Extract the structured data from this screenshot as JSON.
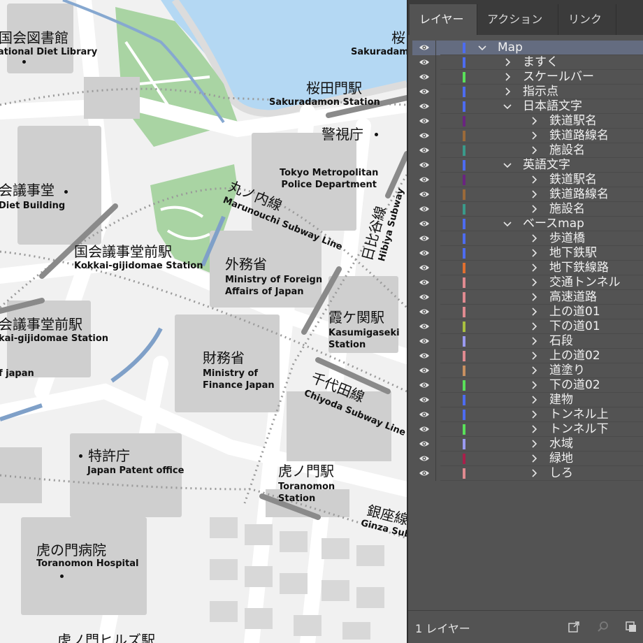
{
  "map": {
    "labels": [
      {
        "jp": "国会図書館",
        "en": "National Diet Library"
      },
      {
        "jp": "桜",
        "en": "Sakuradamon"
      },
      {
        "jp": "桜田門駅",
        "en": "Sakuradamon Station"
      },
      {
        "jp": "警視庁",
        "en": "Tokyo Metropolitan\nPolice Department"
      },
      {
        "jp": "会議事堂",
        "en": "Diet Building"
      },
      {
        "jp": "丸ノ内線",
        "en": "Marunouchi Subway Line"
      },
      {
        "jp": "日比谷線",
        "en": "Hibiya Subway"
      },
      {
        "jp": "国会議事堂前駅",
        "en": "Kokkai-gijidomae Station"
      },
      {
        "jp": "外務省",
        "en": "Ministry of Foreign\nAffairs of Japan"
      },
      {
        "jp": "会議事堂前駅",
        "en": "kai-gijidomae Station"
      },
      {
        "jp": "霞ケ関駅",
        "en": "Kasumigaseki\nStation"
      },
      {
        "jp": "",
        "en": "f japan"
      },
      {
        "jp": "財務省",
        "en": "Ministry of\nFinance Japan"
      },
      {
        "jp": "千代田線",
        "en": "Chiyoda Subway Line"
      },
      {
        "jp": "特許庁",
        "en": "Japan Patent office"
      },
      {
        "jp": "虎ノ門駅",
        "en": "Toranomon\nStation"
      },
      {
        "jp": "銀座線",
        "en": "Ginza Sub"
      },
      {
        "jp": "虎の門病院",
        "en": "Toranomon Hospital"
      },
      {
        "jp": "虎ノ門ヒルズ駅",
        "en": ""
      }
    ]
  },
  "panel": {
    "tabs": [
      "レイヤー",
      "アクション",
      "リンク"
    ],
    "layers": [
      {
        "name": "Map",
        "color": "#4d6cf0",
        "level": 0,
        "expanded": true,
        "selected": true
      },
      {
        "name": "ますく",
        "color": "#4d6cf0",
        "level": 1,
        "expanded": false
      },
      {
        "name": "スケールバー",
        "color": "#5ae05a",
        "level": 1,
        "expanded": false
      },
      {
        "name": "指示点",
        "color": "#4d6cf0",
        "level": 1,
        "expanded": false
      },
      {
        "name": "日本語文字",
        "color": "#4d6cf0",
        "level": 1,
        "expanded": true
      },
      {
        "name": "鉄道駅名",
        "color": "#6a2480",
        "level": 2,
        "expanded": false
      },
      {
        "name": "鉄道路線名",
        "color": "#9a6a3a",
        "level": 2,
        "expanded": false
      },
      {
        "name": "施設名",
        "color": "#3a9a8a",
        "level": 2,
        "expanded": false
      },
      {
        "name": "英語文字",
        "color": "#4d6cf0",
        "level": 1,
        "expanded": true
      },
      {
        "name": "鉄道駅名",
        "color": "#6a2480",
        "level": 2,
        "expanded": false
      },
      {
        "name": "鉄道路線名",
        "color": "#9a6a3a",
        "level": 2,
        "expanded": false
      },
      {
        "name": "施設名",
        "color": "#3a9a8a",
        "level": 2,
        "expanded": false
      },
      {
        "name": "ベースmap",
        "color": "#4d6cf0",
        "level": 1,
        "expanded": true
      },
      {
        "name": "歩道橋",
        "color": "#4d6cf0",
        "level": 2,
        "expanded": false
      },
      {
        "name": "地下鉄駅",
        "color": "#4d6cf0",
        "level": 2,
        "expanded": false
      },
      {
        "name": "地下鉄線路",
        "color": "#e07030",
        "level": 2,
        "expanded": false
      },
      {
        "name": "交通トンネル",
        "color": "#e08a90",
        "level": 2,
        "expanded": false
      },
      {
        "name": "高速道路",
        "color": "#e08a90",
        "level": 2,
        "expanded": false
      },
      {
        "name": "上の道01",
        "color": "#e08a90",
        "level": 2,
        "expanded": false
      },
      {
        "name": "下の道01",
        "color": "#a8c040",
        "level": 2,
        "expanded": false
      },
      {
        "name": "石段",
        "color": "#9a9af0",
        "level": 2,
        "expanded": false
      },
      {
        "name": "上の道02",
        "color": "#e08a90",
        "level": 2,
        "expanded": false
      },
      {
        "name": "道塗り",
        "color": "#c89060",
        "level": 2,
        "expanded": false
      },
      {
        "name": "下の道02",
        "color": "#5ae05a",
        "level": 2,
        "expanded": false
      },
      {
        "name": "建物",
        "color": "#4d6cf0",
        "level": 2,
        "expanded": false
      },
      {
        "name": "トンネル上",
        "color": "#4d6cf0",
        "level": 2,
        "expanded": false
      },
      {
        "name": "トンネル下",
        "color": "#5ae05a",
        "level": 2,
        "expanded": false
      },
      {
        "name": "水域",
        "color": "#9a9af0",
        "level": 2,
        "expanded": false
      },
      {
        "name": "緑地",
        "color": "#a8204a",
        "level": 2,
        "expanded": false
      },
      {
        "name": "しろ",
        "color": "#e08a90",
        "level": 2,
        "expanded": false
      }
    ],
    "footer_count": "1 レイヤー",
    "footer_icons": [
      "export-icon",
      "search-icon",
      "new-layer-icon"
    ]
  }
}
